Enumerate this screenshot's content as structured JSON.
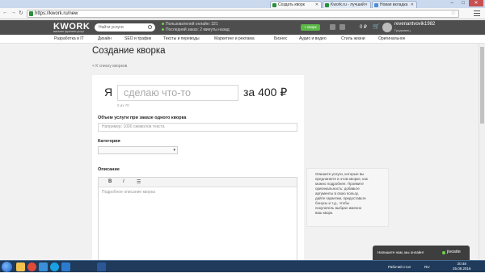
{
  "browser": {
    "tabs": [
      {
        "label": "Создать кворк",
        "active": true,
        "favicon_color": "#2a8f3a"
      },
      {
        "label": "Kwork.ru - лучший",
        "active": false,
        "favicon_color": "#2a8f3a"
      },
      {
        "label": "Новая вкладка",
        "active": false,
        "favicon_color": "#4a8fd8"
      }
    ],
    "window_buttons": [
      "–",
      "□",
      "✕"
    ],
    "url": "https://kwork.ru/new"
  },
  "header": {
    "logo": "KWORK",
    "tagline": "магазин фриланс-услуг",
    "search_placeholder": "Найти услуги",
    "stat_online": "Пользователей онлайн: 321",
    "stat_last_order": "Последний заказ: 2 минуты назад",
    "kwork_button": "+ кворк",
    "balance": "0 ₽",
    "cart_icon": "cart-icon",
    "username": "revenantvovik1982",
    "city": "Гродиявец"
  },
  "categories": [
    "Разработка и IT",
    "Дизайн",
    "SEO и трафик",
    "Тексты и переводы",
    "Маркетинг и реклама",
    "Бизнес",
    "Аудио и видео",
    "Стиль жизни",
    "Оригинальное"
  ],
  "page": {
    "title": "Создание кворка",
    "back_link": "< К списку кворков"
  },
  "form": {
    "prefix": "Я",
    "title_placeholder": "сделаю что-то",
    "price": "за 400 ₽",
    "counter": "0 из 70",
    "volume_label": "Объем услуги при заказе одного кворка",
    "volume_placeholder": "Например: 1000 символов текста",
    "category_label": "Категория",
    "category_value": "",
    "description_label": "Описание",
    "toolbar": [
      "B",
      "I",
      "☰"
    ],
    "description_placeholder": "Подробное описание кворка"
  },
  "hint": {
    "lines": [
      "Опишите услуги, которые вы",
      "предлагаете в этом кворке, как",
      "можно подробнее. Проявите",
      "оригинальность: добавьте",
      "аргументы в свою пользу,",
      "дайте гарантии, предоставьте",
      "бонусы и т.д., чтобы",
      "покупатель выбрал именно",
      "ваш кворк."
    ]
  },
  "chat": {
    "message": "Напишите нам, мы онлайн!",
    "brand": "jivosite"
  },
  "taskbar": {
    "tray_text": "Рабочий стол",
    "lang": "RU",
    "time": "20:48",
    "date": "25.08.2016",
    "app_icons": [
      {
        "name": "explorer-icon",
        "color": "#f2c14e"
      },
      {
        "name": "chrome-icon",
        "color": "#e04a3a"
      },
      {
        "name": "media-icon",
        "color": "#3a8fd8"
      },
      {
        "name": "skype-icon",
        "color": "#1aa1e4"
      },
      {
        "name": "ie-icon",
        "color": "#2d7bd0"
      },
      {
        "name": "word-icon",
        "color": "#2b5797"
      }
    ]
  }
}
